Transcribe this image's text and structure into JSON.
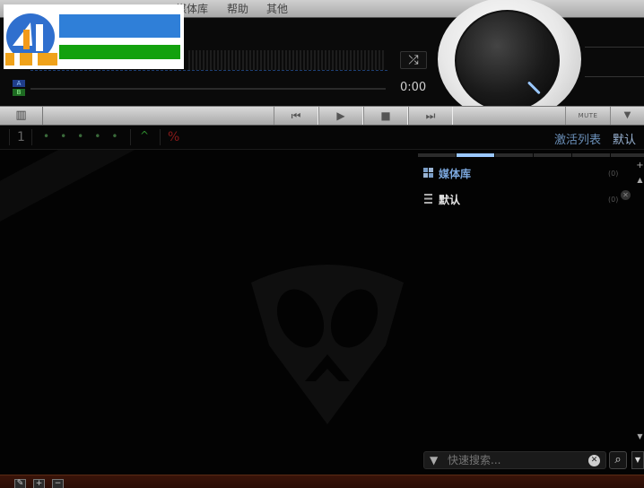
{
  "menu": {
    "items": [
      "媒体库",
      "帮助",
      "其他"
    ]
  },
  "player": {
    "time": "0:00",
    "channel_a": "A",
    "channel_b": "B",
    "mute_label": "MUTE"
  },
  "status": {
    "track_number": "1",
    "playlist_tab": "激活列表",
    "default_tab": "默认"
  },
  "sidebar": {
    "items": [
      {
        "label": "媒体库",
        "count": "(0)",
        "icon": "library-icon"
      },
      {
        "label": "默认",
        "count": "(0)",
        "icon": "list-icon"
      }
    ]
  },
  "search": {
    "placeholder": "快速搜索..."
  },
  "colors": {
    "accent": "#9ac8ff",
    "link": "#6a8fb8",
    "logo_blue": "#2f7fd8",
    "logo_green": "#13a10e"
  }
}
